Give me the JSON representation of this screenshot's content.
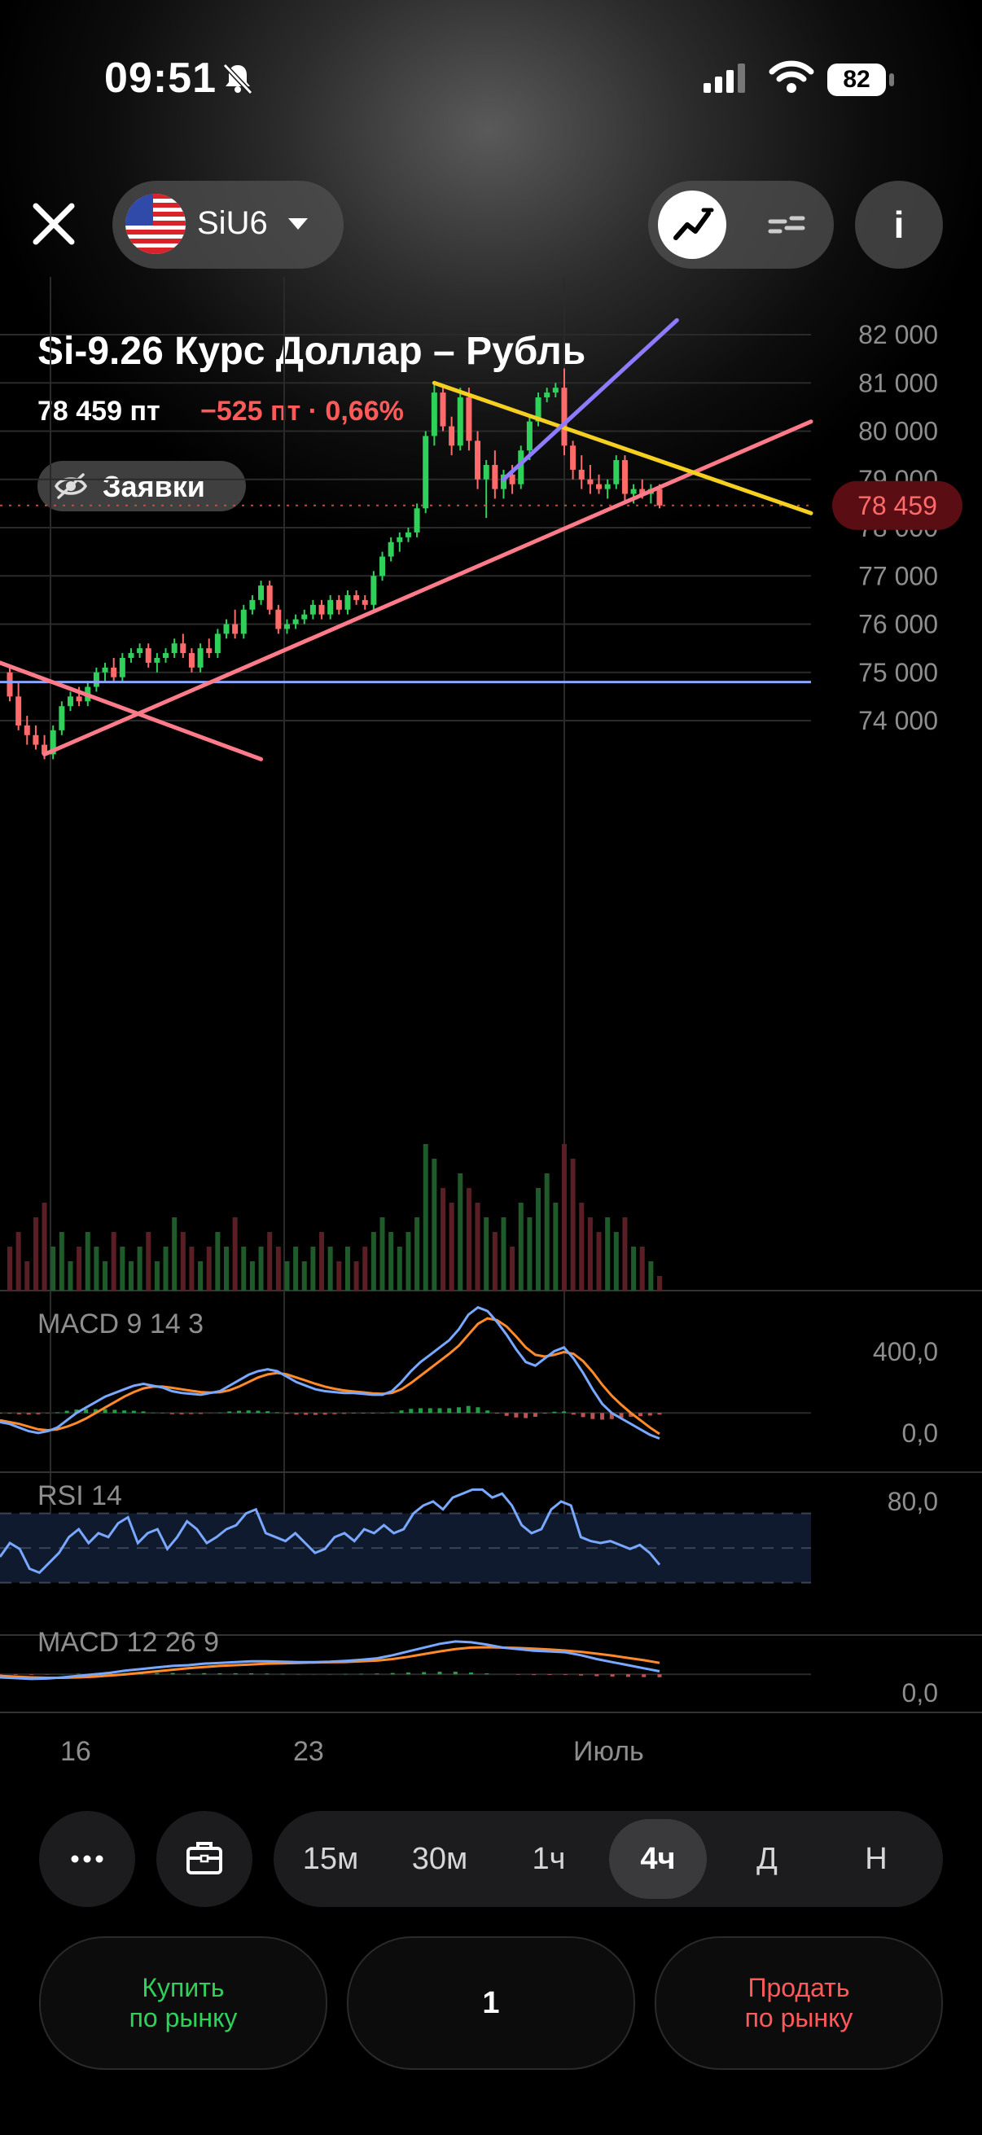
{
  "status_bar": {
    "time": "09:51",
    "battery": "82"
  },
  "toolbar": {
    "ticker": "SiU6"
  },
  "header": {
    "title": "Si-9.26 Курс Доллар – Рубль",
    "price": "78 459 пт",
    "change": "−525 пт · 0,66%",
    "orders_label": "Заявки"
  },
  "colors": {
    "up": "#2fd15a",
    "down": "#ff6b6b",
    "trendline_pink": "#ff7b8a",
    "trendline_yellow": "#f5d020",
    "trendline_purple": "#8d7cff",
    "level_line": "#8aa6ff",
    "macd_line": "#79a8ff",
    "signal_line": "#ff8a2a",
    "rsi_line": "#79a8ff",
    "price_badge": "#5a0d12"
  },
  "chart_data": {
    "type": "candlestick",
    "y_axis_labels": [
      "82 000",
      "81 000",
      "80 000",
      "79 000",
      "78 000",
      "77 000",
      "76 000",
      "75 000",
      "74 000"
    ],
    "ylim": [
      73200,
      82300
    ],
    "current_price_label": "78 459",
    "current_price": 78459,
    "x_axis_labels": [
      "16",
      "23",
      "Июль"
    ],
    "level_line": 74800,
    "candles": [
      [
        75000,
        75100,
        74400,
        74500
      ],
      [
        74500,
        74800,
        73800,
        73900
      ],
      [
        73900,
        74100,
        73500,
        73700
      ],
      [
        73700,
        73900,
        73400,
        73500
      ],
      [
        73500,
        73700,
        73200,
        73300
      ],
      [
        73300,
        73900,
        73200,
        73800
      ],
      [
        73800,
        74400,
        73700,
        74300
      ],
      [
        74300,
        74600,
        74200,
        74500
      ],
      [
        74500,
        74700,
        74300,
        74400
      ],
      [
        74400,
        74800,
        74300,
        74700
      ],
      [
        74700,
        75100,
        74600,
        75000
      ],
      [
        75000,
        75200,
        74800,
        75100
      ],
      [
        75100,
        75300,
        74800,
        74900
      ],
      [
        74900,
        75400,
        74800,
        75300
      ],
      [
        75300,
        75500,
        75200,
        75400
      ],
      [
        75400,
        75600,
        75300,
        75500
      ],
      [
        75500,
        75600,
        75100,
        75200
      ],
      [
        75200,
        75400,
        75000,
        75300
      ],
      [
        75300,
        75500,
        75200,
        75400
      ],
      [
        75400,
        75700,
        75300,
        75600
      ],
      [
        75600,
        75800,
        75300,
        75400
      ],
      [
        75400,
        75500,
        75000,
        75100
      ],
      [
        75100,
        75600,
        75000,
        75500
      ],
      [
        75500,
        75700,
        75300,
        75400
      ],
      [
        75400,
        75900,
        75300,
        75800
      ],
      [
        75800,
        76100,
        75700,
        76000
      ],
      [
        76000,
        76300,
        75700,
        75800
      ],
      [
        75800,
        76400,
        75700,
        76300
      ],
      [
        76300,
        76600,
        76200,
        76500
      ],
      [
        76500,
        76900,
        76400,
        76800
      ],
      [
        76800,
        76900,
        76200,
        76300
      ],
      [
        76300,
        76400,
        75800,
        75900
      ],
      [
        75900,
        76100,
        75800,
        76000
      ],
      [
        76000,
        76200,
        75900,
        76100
      ],
      [
        76100,
        76300,
        76000,
        76200
      ],
      [
        76200,
        76500,
        76100,
        76400
      ],
      [
        76400,
        76500,
        76100,
        76200
      ],
      [
        76200,
        76600,
        76100,
        76500
      ],
      [
        76500,
        76600,
        76200,
        76300
      ],
      [
        76300,
        76700,
        76200,
        76600
      ],
      [
        76600,
        76700,
        76400,
        76500
      ],
      [
        76500,
        76600,
        76300,
        76400
      ],
      [
        76400,
        77100,
        76300,
        77000
      ],
      [
        77000,
        77500,
        76900,
        77400
      ],
      [
        77400,
        77800,
        77300,
        77700
      ],
      [
        77700,
        77900,
        77500,
        77800
      ],
      [
        77800,
        78000,
        77700,
        77900
      ],
      [
        77900,
        78500,
        77800,
        78400
      ],
      [
        78400,
        80000,
        78300,
        79900
      ],
      [
        79900,
        81000,
        79700,
        80800
      ],
      [
        80800,
        80900,
        80000,
        80100
      ],
      [
        80100,
        80300,
        79500,
        79700
      ],
      [
        79700,
        80900,
        79600,
        80700
      ],
      [
        80700,
        80900,
        79600,
        79800
      ],
      [
        79800,
        80000,
        78800,
        79000
      ],
      [
        79000,
        79400,
        78200,
        79300
      ],
      [
        79300,
        79600,
        78600,
        78800
      ],
      [
        78800,
        79200,
        78600,
        79100
      ],
      [
        79100,
        79300,
        78700,
        78900
      ],
      [
        78900,
        79700,
        78800,
        79600
      ],
      [
        79600,
        80300,
        79400,
        80200
      ],
      [
        80200,
        80800,
        80100,
        80700
      ],
      [
        80700,
        80900,
        80600,
        80800
      ],
      [
        80800,
        81000,
        80700,
        80900
      ],
      [
        80900,
        81300,
        79500,
        79700
      ],
      [
        79700,
        79800,
        79000,
        79200
      ],
      [
        79200,
        79500,
        78800,
        79000
      ],
      [
        79000,
        79300,
        78700,
        78900
      ],
      [
        78900,
        79100,
        78700,
        78800
      ],
      [
        78800,
        79000,
        78600,
        78900
      ],
      [
        78900,
        79500,
        78800,
        79400
      ],
      [
        79400,
        79500,
        78500,
        78700
      ],
      [
        78700,
        78900,
        78500,
        78800
      ],
      [
        78800,
        79000,
        78600,
        78700
      ],
      [
        78700,
        78900,
        78500,
        78800
      ],
      [
        78800,
        78900,
        78400,
        78459
      ]
    ],
    "trendlines": [
      {
        "color": "trendline_pink",
        "from": [
          0,
          75200
        ],
        "to": [
          29,
          73200
        ]
      },
      {
        "color": "trendline_pink",
        "from": [
          4,
          73300
        ],
        "to": [
          80,
          80200
        ]
      },
      {
        "color": "trendline_yellow",
        "from": [
          49,
          81000
        ],
        "to": [
          80,
          78300
        ]
      },
      {
        "color": "trendline_purple",
        "from": [
          57,
          79000
        ],
        "to": [
          77,
          82300
        ]
      }
    ],
    "volumes": [
      0.3,
      0.4,
      0.2,
      0.5,
      0.6,
      0.3,
      0.4,
      0.2,
      0.3,
      0.4,
      0.3,
      0.2,
      0.4,
      0.3,
      0.2,
      0.3,
      0.4,
      0.2,
      0.3,
      0.5,
      0.4,
      0.3,
      0.2,
      0.3,
      0.4,
      0.3,
      0.5,
      0.3,
      0.2,
      0.3,
      0.4,
      0.3,
      0.2,
      0.3,
      0.2,
      0.3,
      0.4,
      0.3,
      0.2,
      0.3,
      0.2,
      0.3,
      0.4,
      0.5,
      0.4,
      0.3,
      0.4,
      0.5,
      1.0,
      0.9,
      0.7,
      0.6,
      0.8,
      0.7,
      0.6,
      0.5,
      0.4,
      0.5,
      0.3,
      0.6,
      0.5,
      0.7,
      0.8,
      0.6,
      1.0,
      0.9,
      0.6,
      0.5,
      0.4,
      0.5,
      0.4,
      0.5,
      0.3,
      0.3,
      0.2,
      0.1
    ],
    "macd1": {
      "label": "MACD 9 14 3",
      "y_labels": [
        "400,0",
        "0,0"
      ],
      "ylim": [
        -200,
        650
      ],
      "macd": [
        -50,
        -60,
        -80,
        -100,
        -110,
        -100,
        -80,
        -40,
        0,
        30,
        60,
        90,
        110,
        130,
        150,
        160,
        150,
        140,
        120,
        110,
        105,
        100,
        110,
        120,
        150,
        180,
        210,
        230,
        240,
        230,
        200,
        170,
        150,
        130,
        120,
        115,
        110,
        110,
        105,
        100,
        100,
        120,
        170,
        230,
        280,
        320,
        360,
        400,
        460,
        540,
        580,
        560,
        500,
        430,
        350,
        280,
        260,
        300,
        340,
        360,
        300,
        220,
        130,
        50,
        0,
        -30,
        -60,
        -90,
        -120,
        -140
      ],
      "signal": [
        -40,
        -50,
        -60,
        -75,
        -90,
        -95,
        -90,
        -75,
        -55,
        -30,
        0,
        30,
        60,
        90,
        115,
        135,
        145,
        145,
        138,
        130,
        122,
        115,
        112,
        114,
        125,
        145,
        170,
        195,
        212,
        220,
        212,
        195,
        178,
        160,
        145,
        133,
        124,
        118,
        113,
        108,
        105,
        110,
        130,
        165,
        205,
        245,
        285,
        325,
        370,
        430,
        490,
        520,
        510,
        475,
        420,
        360,
        320,
        310,
        320,
        335,
        325,
        285,
        225,
        155,
        95,
        45,
        0,
        -40,
        -80,
        -115
      ],
      "hist_color_up": "#2fd15a",
      "hist_color_down": "#ff6b6b"
    },
    "rsi": {
      "label": "RSI 14",
      "y_labels": [
        "80,0"
      ],
      "ylim": [
        20,
        90
      ],
      "values": [
        48,
        55,
        52,
        42,
        40,
        45,
        50,
        58,
        62,
        55,
        60,
        58,
        65,
        68,
        55,
        60,
        62,
        52,
        58,
        66,
        62,
        55,
        58,
        62,
        64,
        70,
        72,
        60,
        58,
        56,
        60,
        55,
        50,
        52,
        58,
        60,
        56,
        62,
        60,
        64,
        60,
        62,
        70,
        74,
        76,
        72,
        78,
        80,
        82,
        82,
        78,
        80,
        74,
        64,
        60,
        62,
        72,
        76,
        74,
        58,
        56,
        55,
        56,
        54,
        52,
        54,
        50,
        44
      ],
      "band": [
        35,
        70
      ]
    },
    "macd2": {
      "label": "MACD 12 26 9",
      "y_labels": [
        "0,0"
      ],
      "ylim": [
        -200,
        600
      ],
      "macd": [
        -40,
        -50,
        -60,
        -55,
        -40,
        -20,
        0,
        20,
        50,
        70,
        90,
        110,
        120,
        140,
        150,
        160,
        170,
        170,
        165,
        160,
        160,
        165,
        175,
        190,
        210,
        250,
        300,
        350,
        400,
        430,
        420,
        390,
        350,
        330,
        310,
        300,
        290,
        250,
        200,
        160,
        120,
        80,
        40
      ],
      "signal": [
        -20,
        -30,
        -40,
        -45,
        -45,
        -40,
        -30,
        -15,
        0,
        20,
        40,
        60,
        80,
        95,
        110,
        120,
        130,
        140,
        145,
        150,
        155,
        158,
        162,
        170,
        180,
        200,
        230,
        265,
        300,
        330,
        350,
        355,
        350,
        345,
        335,
        325,
        312,
        295,
        270,
        245,
        215,
        185,
        150
      ],
      "hist_color_up": "#2fd15a",
      "hist_color_down": "#ff6b6b"
    }
  },
  "timeframes": {
    "items": [
      "15м",
      "30м",
      "1ч",
      "4ч",
      "Д",
      "Н"
    ],
    "selected": "4ч"
  },
  "trade": {
    "buy_line1": "Купить",
    "buy_line2": "по рынку",
    "quantity": "1",
    "sell_line1": "Продать",
    "sell_line2": "по рынку"
  }
}
